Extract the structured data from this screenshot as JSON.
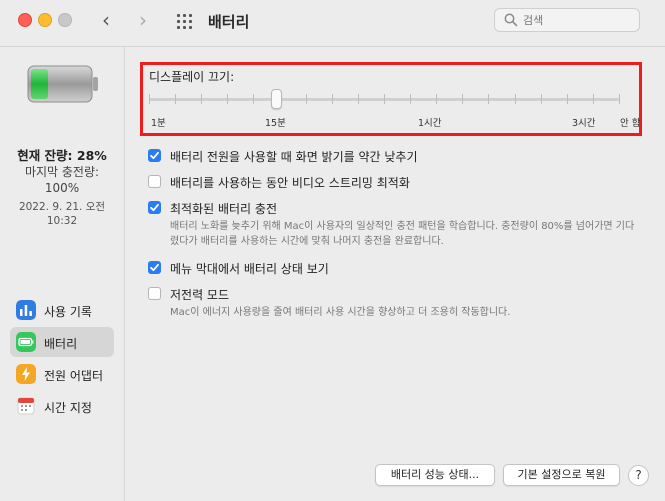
{
  "window": {
    "title": "배터리"
  },
  "search": {
    "placeholder": "검색"
  },
  "sidebar": {
    "status_main": "현재 잔량: 28%",
    "status_sub": "마지막 충전량:",
    "status_pct": "100%",
    "status_date_line1": "2022. 9. 21. 오전",
    "status_date_line2": "10:32",
    "items": [
      {
        "label": "사용 기록",
        "icon": "usage-history-icon",
        "color": "#2f7de1"
      },
      {
        "label": "배터리",
        "icon": "battery-icon",
        "color": "#34c759"
      },
      {
        "label": "전원 어댑터",
        "icon": "power-adapter-icon",
        "color": "#f5a623"
      },
      {
        "label": "시간 지정",
        "icon": "calendar-icon",
        "color": "#e5463b"
      }
    ]
  },
  "display_sleep": {
    "label": "디스플레이 끄기:",
    "value_label": "15분",
    "tick_labels": [
      "1분",
      "15분",
      "1시간",
      "3시간",
      "안 함"
    ]
  },
  "options": [
    {
      "label": "배터리 전원을 사용할 때 화면 밝기를 약간 낮추기",
      "checked": true
    },
    {
      "label": "배터리를 사용하는 동안 비디오 스트리밍 최적화",
      "checked": false
    },
    {
      "label": "최적화된 배터리 충전",
      "checked": true,
      "desc": "배터리 노화를 늦추기 위해 Mac이 사용자의 일상적인 충전 패턴을 학습합니다. 충전량이 80%를 넘어가면 기다렸다가 배터리를 사용하는 시간에 맞춰 나머지 충전을 완료합니다."
    },
    {
      "label": "메뉴 막대에서 배터리 상태 보기",
      "checked": true
    },
    {
      "label": "저전력 모드",
      "checked": false,
      "desc": "Mac이 에너지 사용량을 줄여 배터리 사용 시간을 향상하고 더 조용히 작동합니다."
    }
  ],
  "buttons": {
    "battery_health": "배터리 성능 상태...",
    "restore_defaults": "기본 설정으로 복원",
    "help": "?"
  },
  "colors": {
    "accent": "#2b7bf5",
    "highlight_box": "#ee1c1c",
    "battery_level": "#34c759"
  }
}
